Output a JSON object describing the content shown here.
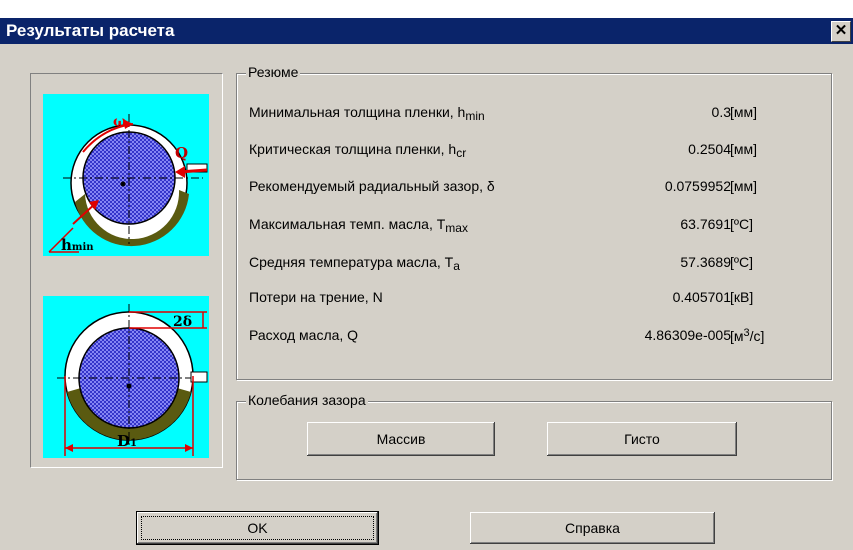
{
  "window": {
    "title": "Результаты расчета",
    "close_label": "×"
  },
  "figures": {
    "top": {
      "omega_label": "ω",
      "load_label": "Q",
      "hmin_label": "h",
      "hmin_sub": "min"
    },
    "bottom": {
      "delta_label": "2δ",
      "d_label": "D",
      "d_sub": "1"
    }
  },
  "summary": {
    "title": "Резюме",
    "rows": [
      {
        "label": "Минимальная толщина пленки, h",
        "sub": "min",
        "value": "0.3",
        "unit": "[мм]"
      },
      {
        "label": "Критическая толщина пленки,  h",
        "sub": "cr",
        "value": "0.2504",
        "unit": "[мм]"
      },
      {
        "label": "Рекомендуемый радиальный зазор, δ",
        "sub": "",
        "value": "0.0759952",
        "unit": "[мм]"
      },
      {
        "label": "Максимальная темп. масла,  T",
        "sub": "max",
        "value": "63.7691",
        "unit": "[ºC]"
      },
      {
        "label": "Средняя температура масла,  T",
        "sub": "a",
        "value": "57.3689",
        "unit": "[ºC]"
      },
      {
        "label": "Потери на трение, N",
        "sub": "",
        "value": "0.405701",
        "unit": "[кВ]"
      },
      {
        "label": "Расход масла, Q",
        "sub": "",
        "value": "4.86309e-005",
        "unit": "[м",
        "unit_sup": "3",
        "unit_tail": "/c]"
      }
    ]
  },
  "oscillation": {
    "title": "Колебания зазора",
    "massive_button": "Массив",
    "histo_button": "Гисто"
  },
  "footer": {
    "ok_button": "OK",
    "help_button": "Справка"
  }
}
